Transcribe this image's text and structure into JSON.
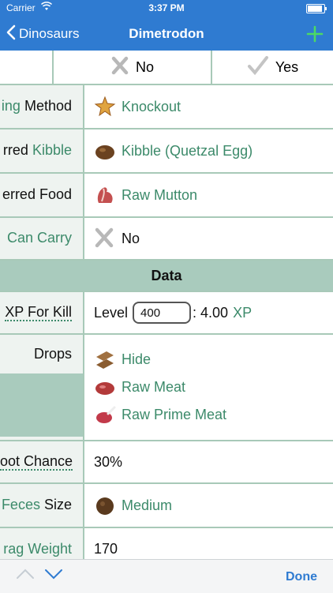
{
  "status_bar": {
    "carrier": "Carrier",
    "time": "3:37 PM"
  },
  "nav": {
    "back_label": "Dinosaurs",
    "title": "Dimetrodon",
    "add_icon": "plus-icon"
  },
  "top_row": {
    "no_label": "No",
    "yes_label": "Yes"
  },
  "rows": {
    "taming_method": {
      "label_part1": "ing",
      "label_part2": "Method",
      "value": "Knockout"
    },
    "preferred_kibble": {
      "label_part1": "rred",
      "label_part2": "Kibble",
      "value": "Kibble (Quetzal Egg)"
    },
    "preferred_food": {
      "label": "erred Food",
      "value": "Raw Mutton"
    },
    "can_carry": {
      "label": "Can Carry",
      "value": "No"
    }
  },
  "section_title": "Data",
  "xp": {
    "label": "XP For Kill",
    "level_label": "Level",
    "level_value": "400",
    "result": ": 4.00",
    "unit": "XP"
  },
  "drops": {
    "label": "Drops",
    "items": [
      "Hide",
      "Raw Meat",
      "Raw Prime Meat"
    ]
  },
  "loot_chance": {
    "label": "oot Chance",
    "value": "30%"
  },
  "feces": {
    "label_part1": "Feces",
    "label_part2": "Size",
    "value": "Medium"
  },
  "drag_weight": {
    "label": "rag Weight",
    "value": "170"
  },
  "toolbar": {
    "done_label": "Done"
  },
  "colors": {
    "nav_blue": "#2f7bd1",
    "accent_green": "#3c8a6a",
    "section_bg": "#a9cbbd",
    "add_green": "#4cd964"
  }
}
